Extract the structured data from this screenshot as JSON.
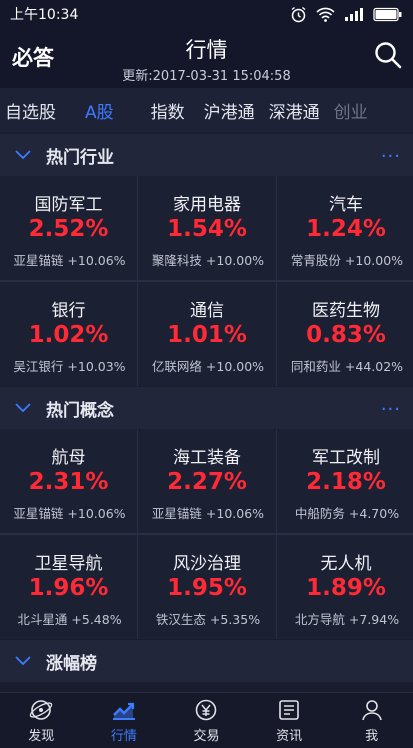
{
  "status": {
    "time": "上午10:34",
    "battery": "100"
  },
  "header": {
    "brand": "必答",
    "title": "行情",
    "updated": "更新:2017-03-31 15:04:58"
  },
  "tabs": [
    {
      "label": "自选股"
    },
    {
      "label": "A股"
    },
    {
      "label": "指数"
    },
    {
      "label": "沪港通"
    },
    {
      "label": "深港通"
    },
    {
      "label": "创业"
    }
  ],
  "sections": {
    "industry": {
      "label": "热门行业",
      "more": "···"
    },
    "concept": {
      "label": "热门概念",
      "more": "···"
    },
    "gainers": {
      "label": "涨幅榜"
    }
  },
  "industry": [
    {
      "name": "国防军工",
      "pct": "2.52%",
      "leader": "亚星锚链",
      "leader_pct": "+10.06%"
    },
    {
      "name": "家用电器",
      "pct": "1.54%",
      "leader": "聚隆科技",
      "leader_pct": "+10.00%"
    },
    {
      "name": "汽车",
      "pct": "1.24%",
      "leader": "常青股份",
      "leader_pct": "+10.00%"
    },
    {
      "name": "银行",
      "pct": "1.02%",
      "leader": "吴江银行",
      "leader_pct": "+10.03%"
    },
    {
      "name": "通信",
      "pct": "1.01%",
      "leader": "亿联网络",
      "leader_pct": "+10.00%"
    },
    {
      "name": "医药生物",
      "pct": "0.83%",
      "leader": "同和药业",
      "leader_pct": "+44.02%"
    }
  ],
  "concept": [
    {
      "name": "航母",
      "pct": "2.31%",
      "leader": "亚星锚链",
      "leader_pct": "+10.06%"
    },
    {
      "name": "海工装备",
      "pct": "2.27%",
      "leader": "亚星锚链",
      "leader_pct": "+10.06%"
    },
    {
      "name": "军工改制",
      "pct": "2.18%",
      "leader": "中船防务",
      "leader_pct": "+4.70%"
    },
    {
      "name": "卫星导航",
      "pct": "1.96%",
      "leader": "北斗星通",
      "leader_pct": "+5.48%"
    },
    {
      "name": "风沙治理",
      "pct": "1.95%",
      "leader": "铁汉生态",
      "leader_pct": "+5.35%"
    },
    {
      "name": "无人机",
      "pct": "1.89%",
      "leader": "北方导航",
      "leader_pct": "+7.94%"
    }
  ],
  "nav": [
    {
      "label": "发现",
      "icon": "discover-icon"
    },
    {
      "label": "行情",
      "icon": "chart-icon"
    },
    {
      "label": "交易",
      "icon": "trade-icon"
    },
    {
      "label": "资讯",
      "icon": "news-icon"
    },
    {
      "label": "我",
      "icon": "user-icon"
    }
  ],
  "colors": {
    "accent": "#3d7bff",
    "up": "#ff2a35",
    "background": "#1a1d2e"
  }
}
